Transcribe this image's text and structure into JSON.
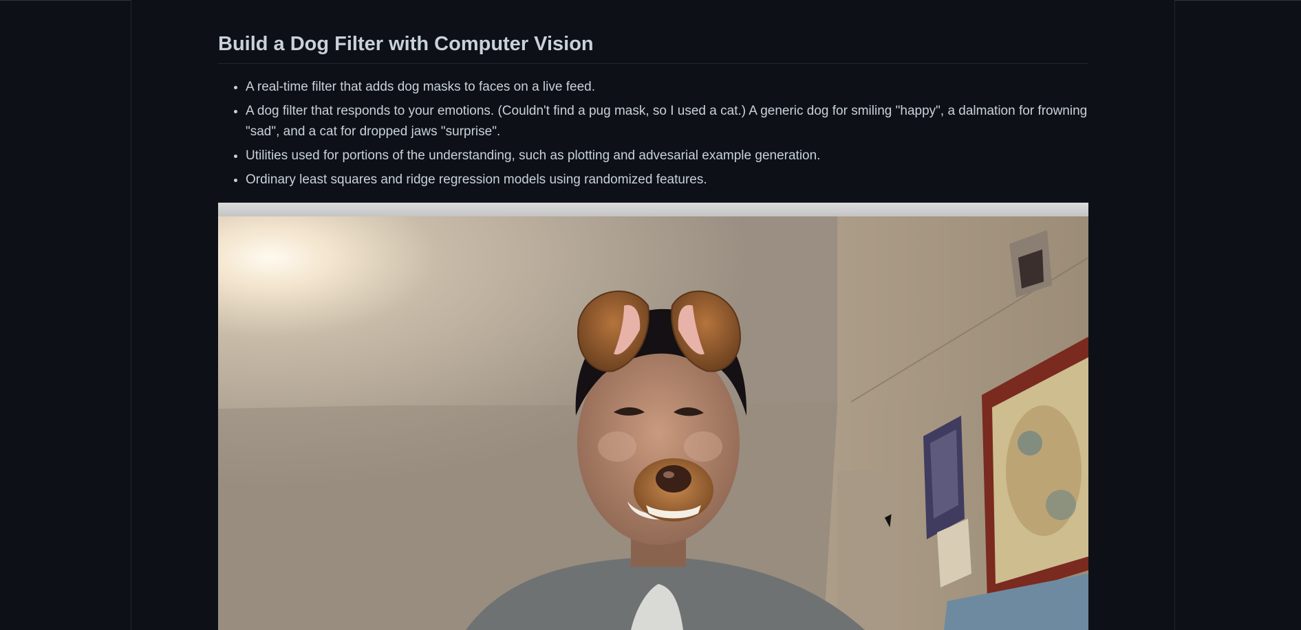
{
  "article": {
    "title": "Build a Dog Filter with Computer Vision",
    "bullets": [
      "A real-time filter that adds dog masks to faces on a live feed.",
      "A dog filter that responds to your emotions. (Couldn't find a pug mask, so I used a cat.) A generic dog for smiling \"happy\", a dalmation for frowning \"sad\", and a cat for dropped jaws \"surprise\".",
      "Utilities used for portions of the understanding, such as plotting and advesarial example generation.",
      "Ordinary least squares and ridge regression models using randomized features."
    ]
  },
  "media": {
    "kind": "animated-gif",
    "description_icon": "webcam-dog-filter-image"
  },
  "colors": {
    "background": "#0d1117",
    "text": "#c9d1d9",
    "border": "#21262d"
  }
}
